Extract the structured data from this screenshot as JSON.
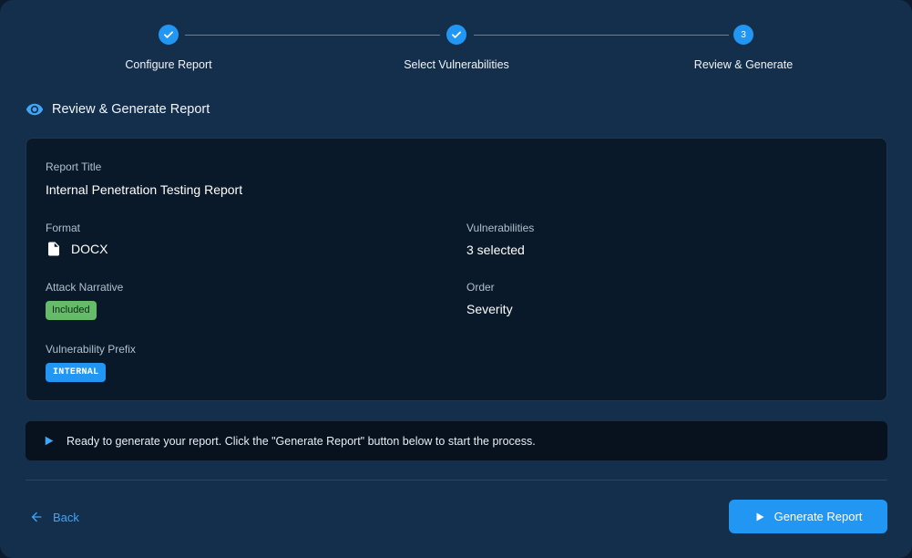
{
  "stepper": {
    "steps": [
      {
        "label": "Configure Report",
        "state": "completed",
        "icon": "check-icon"
      },
      {
        "label": "Select Vulnerabilities",
        "state": "completed",
        "icon": "check-icon"
      },
      {
        "label": "Review & Generate",
        "state": "active",
        "number": "3"
      }
    ]
  },
  "heading": {
    "icon": "eye-icon",
    "title": "Review & Generate Report"
  },
  "summary": {
    "report_title": {
      "label": "Report Title",
      "value": "Internal Penetration Testing Report"
    },
    "format": {
      "label": "Format",
      "value": "DOCX",
      "icon": "file-icon"
    },
    "vulnerabilities": {
      "label": "Vulnerabilities",
      "value": "3 selected"
    },
    "attack_narrative": {
      "label": "Attack Narrative",
      "value": "Included"
    },
    "order": {
      "label": "Order",
      "value": "Severity"
    },
    "vulnerability_prefix": {
      "label": "Vulnerability Prefix",
      "value": "INTERNAL"
    }
  },
  "info": {
    "icon": "play-icon",
    "text": "Ready to generate your report. Click the \"Generate Report\" button below to start the process."
  },
  "actions": {
    "back_label": "Back",
    "back_icon": "arrow-left-icon",
    "generate_label": "Generate Report",
    "generate_icon": "play-icon"
  },
  "colors": {
    "accent": "#2196f3",
    "success": "#66bb6a",
    "background": "#132f4c",
    "card": "#0a1929"
  }
}
